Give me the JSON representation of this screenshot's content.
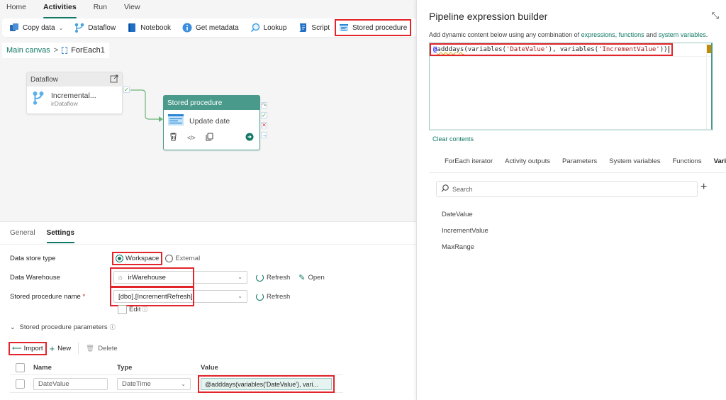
{
  "menu": {
    "tabs": [
      {
        "label": "Home",
        "active": false
      },
      {
        "label": "Activities",
        "active": true
      },
      {
        "label": "Run",
        "active": false
      },
      {
        "label": "View",
        "active": false
      }
    ]
  },
  "toolbar": {
    "items": [
      {
        "label": "Copy data",
        "icon": "copy-data-icon",
        "dropdown": true
      },
      {
        "label": "Dataflow",
        "icon": "dataflow-icon"
      },
      {
        "label": "Notebook",
        "icon": "notebook-icon"
      },
      {
        "label": "Get metadata",
        "icon": "info-icon"
      },
      {
        "label": "Lookup",
        "icon": "search-icon"
      },
      {
        "label": "Script",
        "icon": "script-icon"
      },
      {
        "label": "Stored procedure",
        "icon": "stored-procedure-icon",
        "highlighted": true
      }
    ]
  },
  "breadcrumb": {
    "root": "Main canvas",
    "separator": ">",
    "current": "ForEach1"
  },
  "canvas": {
    "dataflow_node": {
      "header": "Dataflow",
      "title": "Incremental...",
      "subtitle": "irDataflow"
    },
    "sp_node": {
      "header": "Stored procedure",
      "title": "Update date"
    },
    "ports": [
      "skip",
      "success",
      "failure",
      "completion"
    ]
  },
  "settings": {
    "tabs": [
      {
        "label": "General",
        "active": false
      },
      {
        "label": "Settings",
        "active": true
      }
    ],
    "data_store_type": {
      "label": "Data store type",
      "options": [
        "Workspace",
        "External"
      ],
      "selected": "Workspace"
    },
    "data_warehouse": {
      "label": "Data Warehouse",
      "value": "irWarehouse",
      "refresh": "Refresh",
      "open": "Open"
    },
    "stored_procedure_name": {
      "label": "Stored procedure name",
      "required_mark": "*",
      "value": "[dbo].[IncrementRefresh]",
      "refresh": "Refresh",
      "edit_label": "Edit"
    },
    "parameters": {
      "section_label": "Stored procedure parameters",
      "import": "Import",
      "new": "New",
      "delete": "Delete",
      "columns": [
        "Name",
        "Type",
        "Value"
      ],
      "rows": [
        {
          "name": "DateValue",
          "type": "DateTime",
          "value": "@adddays(variables('DateValue'), vari..."
        }
      ]
    }
  },
  "expression_builder": {
    "title": "Pipeline expression builder",
    "description_prefix": "Add dynamic content below using any combination of ",
    "link_expressions": "expressions, functions",
    "description_and": " and ",
    "link_sysvars": "system variables",
    "description_suffix": ".",
    "code": {
      "at": "@",
      "fn": "adddays",
      "p1": "(variables(",
      "s1": "'DateValue'",
      "p2": "), variables(",
      "s2": "'IncrementValue'",
      "p3": "))"
    },
    "clear_contents": "Clear contents",
    "tabs": [
      {
        "label": "ForEach iterator",
        "active": false
      },
      {
        "label": "Activity outputs",
        "active": false
      },
      {
        "label": "Parameters",
        "active": false
      },
      {
        "label": "System variables",
        "active": false
      },
      {
        "label": "Functions",
        "active": false
      },
      {
        "label": "Vari",
        "active": true
      }
    ],
    "search_placeholder": "Search",
    "variables": [
      "DateValue",
      "IncrementValue",
      "MaxRange"
    ]
  },
  "colors": {
    "accent": "#117865",
    "node_header": "#4a9a8b",
    "highlight": "#e3242b"
  }
}
